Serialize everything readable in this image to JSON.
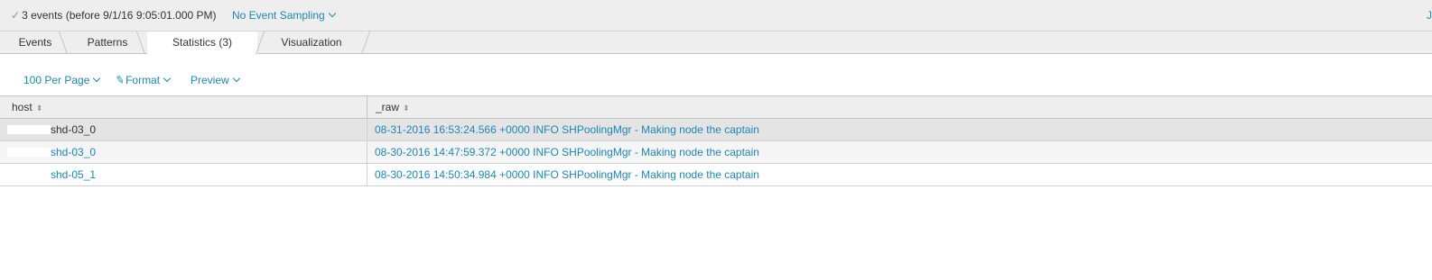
{
  "topbar": {
    "status_check": "✓",
    "status_text": "3 events (before 9/1/16 9:05:01.000 PM)",
    "sampling_label": "No Event Sampling",
    "corner_label": "Jo"
  },
  "tabs": [
    {
      "label": "Events"
    },
    {
      "label": "Patterns"
    },
    {
      "label": "Statistics (3)",
      "active": true
    },
    {
      "label": "Visualization"
    }
  ],
  "toolbar": {
    "per_page_label": "100 Per Page",
    "format_label": "Format",
    "preview_label": "Preview"
  },
  "table": {
    "columns": [
      "host",
      "_raw"
    ],
    "rows": [
      {
        "host": "shd-03_0",
        "raw": "08-31-2016 16:53:24.566 +0000 INFO SHPoolingMgr - Making node the captain"
      },
      {
        "host": "shd-03_0",
        "raw": "08-30-2016 14:47:59.372 +0000 INFO SHPoolingMgr - Making node the captain"
      },
      {
        "host": "shd-05_1",
        "raw": "08-30-2016 14:50:34.984 +0000 INFO SHPoolingMgr - Making node the captain"
      }
    ]
  },
  "colors": {
    "link": "#1e86b3",
    "header_bg": "#eeeeee",
    "selected_row_bg": "#e4e4e4",
    "alt_row_bg": "#f5f5f5"
  }
}
